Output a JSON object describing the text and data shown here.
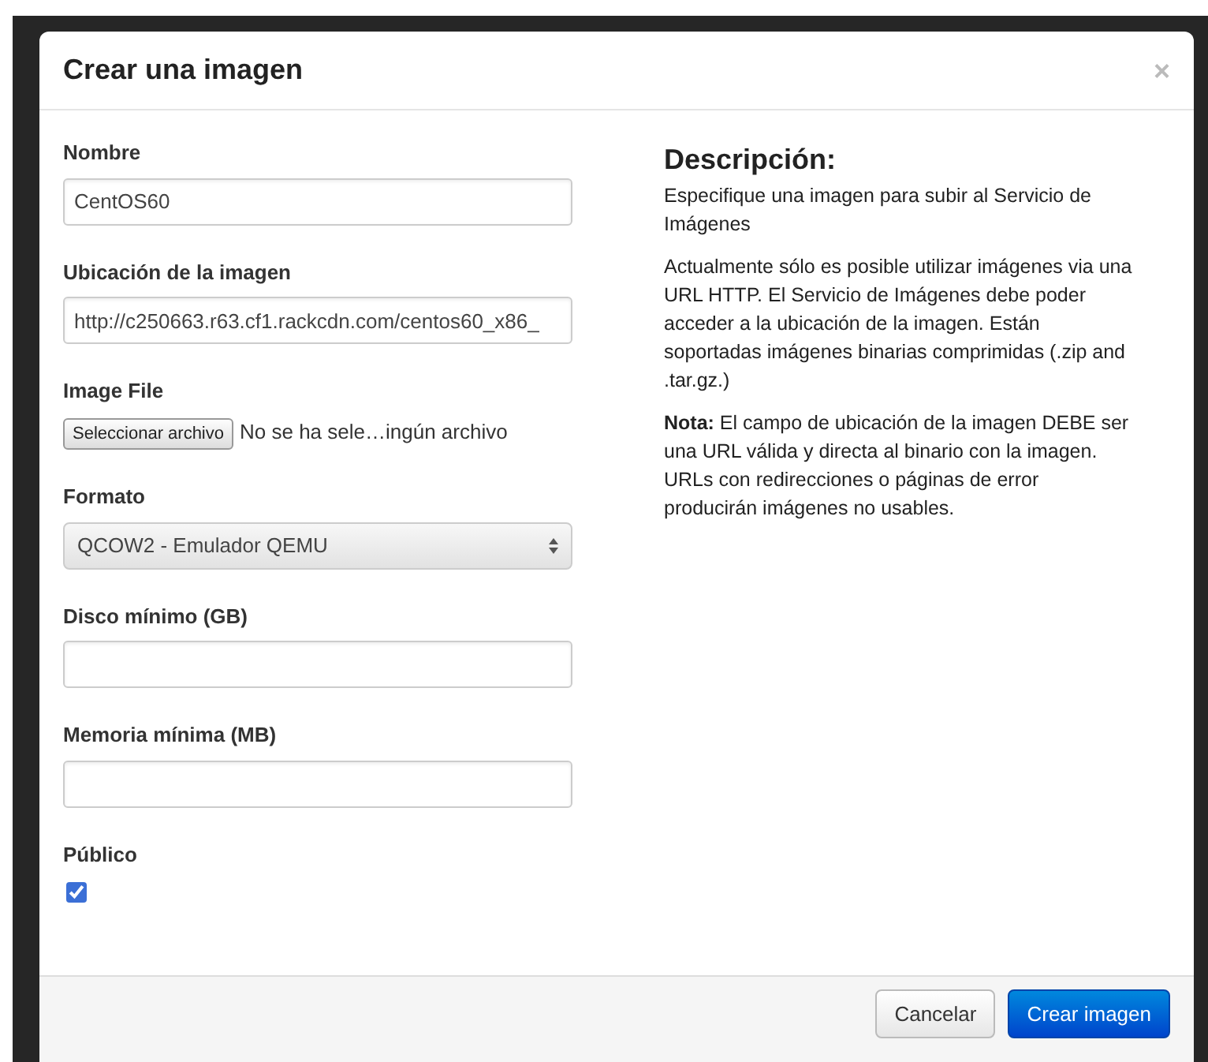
{
  "dialog": {
    "title": "Crear una imagen",
    "close": "×"
  },
  "fields": [
    {
      "kind": "text",
      "label": "Nombre",
      "value": "CentOS60"
    },
    {
      "kind": "text",
      "label": "Ubicación de la imagen",
      "value": "http://c250663.r63.cf1.rackcdn.com/centos60_x86_"
    },
    {
      "kind": "file",
      "label": "Image File",
      "button": "Seleccionar archivo",
      "status": "No se ha sele…ingún archivo"
    },
    {
      "kind": "select",
      "label": "Formato",
      "value": "QCOW2 - Emulador QEMU"
    },
    {
      "kind": "text",
      "label": "Disco mínimo (GB)"
    },
    {
      "kind": "text",
      "label": "Memoria mínima (MB)"
    },
    {
      "kind": "checkbox",
      "label": "Público",
      "checked": true
    }
  ],
  "description": {
    "heading": "Descripción:",
    "paragraphs": [
      "Especifique una imagen para subir al Servicio de Imágenes",
      "Actualmente sólo es posible utilizar imágenes via una URL HTTP. El Servicio de Imágenes debe poder acceder a la ubicación de la imagen. Están soportadas imágenes binarias comprimidas (.zip and .tar.gz.)",
      "**Nota:** El campo de ubicación de la imagen DEBE ser una URL válida y directa al binario con la imagen. URLs con redirecciones o páginas de error producirán imágenes no usables."
    ]
  },
  "buttons": [
    {
      "kind": "secondary",
      "label": "Cancelar"
    },
    {
      "kind": "primary",
      "label": "Crear imagen"
    }
  ]
}
